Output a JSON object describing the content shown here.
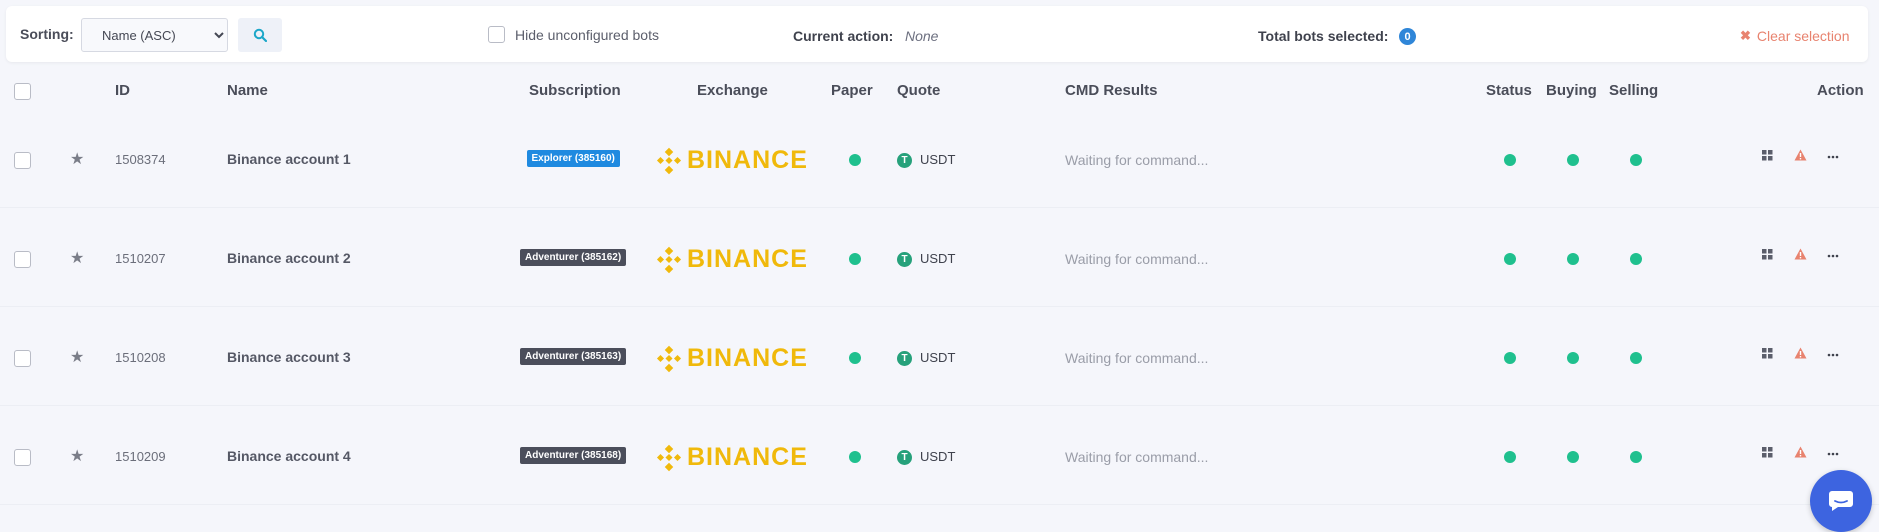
{
  "toolbar": {
    "sorting_label": "Sorting:",
    "sort_value": "Name (ASC)",
    "hide_unconfigured_label": "Hide unconfigured bots",
    "current_action_label": "Current action:",
    "current_action_value": "None",
    "total_selected_label": "Total bots selected:",
    "total_selected_count": "0",
    "clear_selection_label": "Clear selection"
  },
  "columns": {
    "id": "ID",
    "name": "Name",
    "subscription": "Subscription",
    "exchange": "Exchange",
    "paper": "Paper",
    "quote": "Quote",
    "cmd_results": "CMD Results",
    "status": "Status",
    "buying": "Buying",
    "selling": "Selling",
    "action": "Action"
  },
  "rows": [
    {
      "id": "1508374",
      "name": "Binance account 1",
      "subscription": "Explorer (385160)",
      "subscription_color": "#1f8ae0",
      "exchange": "BINANCE",
      "quote_icon": "T",
      "quote": "USDT",
      "cmd": "Waiting for command..."
    },
    {
      "id": "1510207",
      "name": "Binance account 2",
      "subscription": "Adventurer (385162)",
      "subscription_color": "#4b4e5b",
      "exchange": "BINANCE",
      "quote_icon": "T",
      "quote": "USDT",
      "cmd": "Waiting for command..."
    },
    {
      "id": "1510208",
      "name": "Binance account 3",
      "subscription": "Adventurer (385163)",
      "subscription_color": "#4b4e5b",
      "exchange": "BINANCE",
      "quote_icon": "T",
      "quote": "USDT",
      "cmd": "Waiting for command..."
    },
    {
      "id": "1510209",
      "name": "Binance account 4",
      "subscription": "Adventurer (385168)",
      "subscription_color": "#4b4e5b",
      "exchange": "BINANCE",
      "quote_icon": "T",
      "quote": "USDT",
      "cmd": "Waiting for command..."
    }
  ],
  "colors": {
    "status_green": "#1fc08e",
    "binance_yellow": "#f0b90b",
    "clear_red": "#e8836f",
    "badge_blue": "#2f86d8",
    "chat_blue": "#3d64e0"
  },
  "icons": {
    "search": "search-icon",
    "star": "star-icon",
    "grid": "grid-icon",
    "warning": "warning-icon",
    "more": "more-icon",
    "chat": "chat-icon",
    "close": "close-icon"
  }
}
